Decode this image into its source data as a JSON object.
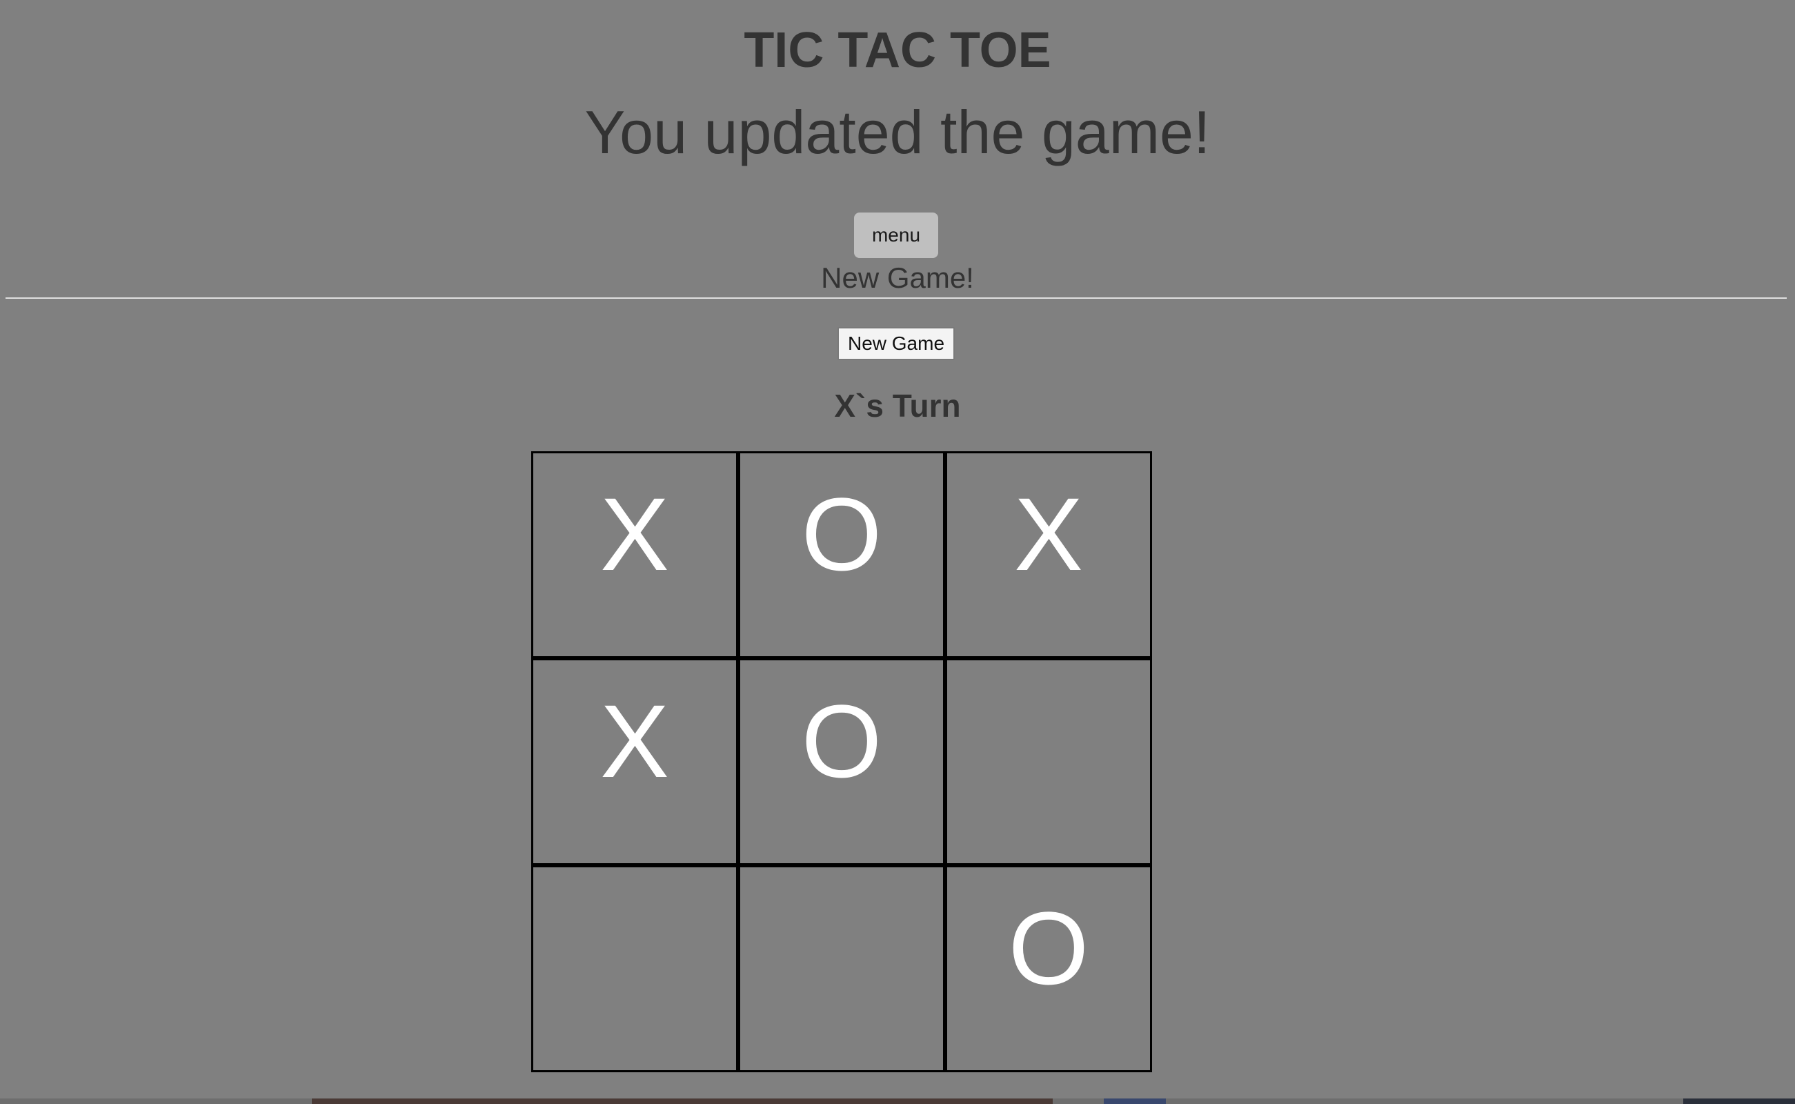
{
  "header": {
    "title": "TIC TAC TOE",
    "message": "You updated the game!"
  },
  "menu": {
    "button_label": "menu"
  },
  "new_game_section": {
    "heading": "New Game!",
    "button_label": "New Game"
  },
  "status": {
    "turn_text": "X`s Turn"
  },
  "board": {
    "cells": [
      "X",
      "O",
      "X",
      "X",
      "O",
      "",
      "",
      "",
      "O"
    ]
  },
  "colors": {
    "background": "#808080",
    "text": "#333333",
    "mark": "#ffffff",
    "grid_line": "#000000"
  }
}
